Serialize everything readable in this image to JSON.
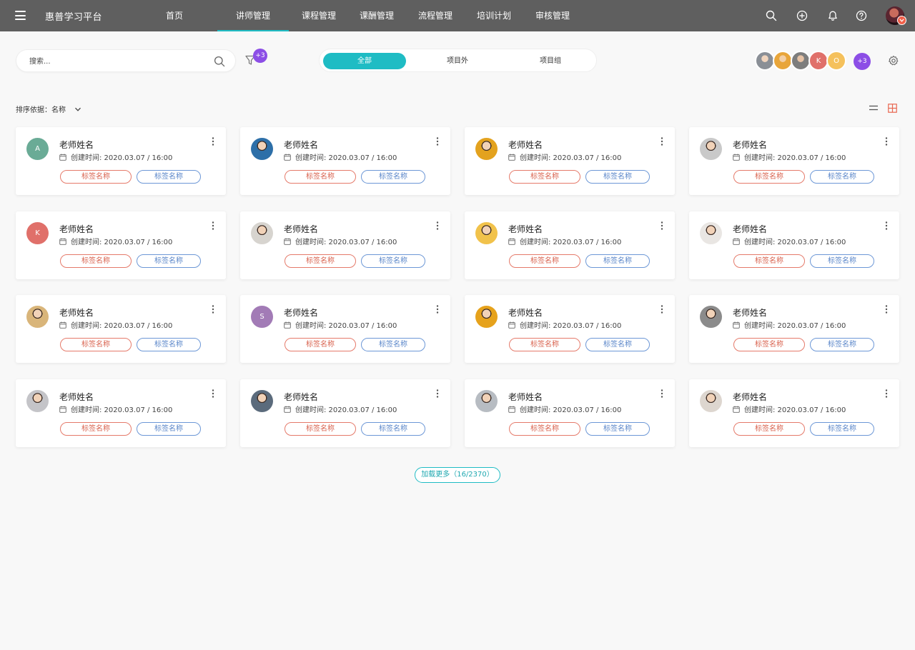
{
  "app": {
    "title": "惠普学习平台"
  },
  "nav": {
    "items": [
      {
        "label": "首页",
        "active": false
      },
      {
        "label": "讲师管理",
        "active": true
      },
      {
        "label": "课程管理",
        "active": false
      },
      {
        "label": "课酬管理",
        "active": false
      },
      {
        "label": "流程管理",
        "active": false
      },
      {
        "label": "培训计划",
        "active": false
      },
      {
        "label": "审核管理",
        "active": false
      }
    ]
  },
  "search": {
    "placeholder": "搜索...",
    "value": ""
  },
  "filter": {
    "badge": "+3"
  },
  "segments": [
    {
      "label": "全部",
      "active": true
    },
    {
      "label": "项目外",
      "active": false
    },
    {
      "label": "项目组",
      "active": false
    }
  ],
  "people": {
    "avatars": [
      {
        "initial": "",
        "color": "#8a8f96"
      },
      {
        "initial": "",
        "color": "#e8a53a"
      },
      {
        "initial": "",
        "color": "#7d7d7d"
      },
      {
        "initial": "K",
        "color": "#e0706a"
      },
      {
        "initial": "O",
        "color": "#f5c15c"
      }
    ],
    "more": "+3"
  },
  "sort": {
    "label": "排序依据：",
    "value": "名称"
  },
  "cards": [
    {
      "name": "老师姓名",
      "date": "创建时间: 2020.03.07 / 16:00",
      "initial": "A",
      "color": "#6aab96",
      "tag_red": "标签名称",
      "tag_blue": "标签名称"
    },
    {
      "name": "老师姓名",
      "date": "创建时间: 2020.03.07 / 16:00",
      "initial": "",
      "color": "#2d6fa8",
      "tag_red": "标签名称",
      "tag_blue": "标签名称"
    },
    {
      "name": "老师姓名",
      "date": "创建时间: 2020.03.07 / 16:00",
      "initial": "",
      "color": "#e3a21e",
      "tag_red": "标签名称",
      "tag_blue": "标签名称"
    },
    {
      "name": "老师姓名",
      "date": "创建时间: 2020.03.07 / 16:00",
      "initial": "",
      "color": "#c9c9c9",
      "tag_red": "标签名称",
      "tag_blue": "标签名称"
    },
    {
      "name": "老师姓名",
      "date": "创建时间: 2020.03.07 / 16:00",
      "initial": "K",
      "color": "#e0706a",
      "tag_red": "标签名称",
      "tag_blue": "标签名称"
    },
    {
      "name": "老师姓名",
      "date": "创建时间: 2020.03.07 / 16:00",
      "initial": "",
      "color": "#d7d4cf",
      "tag_red": "标签名称",
      "tag_blue": "标签名称"
    },
    {
      "name": "老师姓名",
      "date": "创建时间: 2020.03.07 / 16:00",
      "initial": "",
      "color": "#f1c24b",
      "tag_red": "标签名称",
      "tag_blue": "标签名称"
    },
    {
      "name": "老师姓名",
      "date": "创建时间: 2020.03.07 / 16:00",
      "initial": "",
      "color": "#e9e6e3",
      "tag_red": "标签名称",
      "tag_blue": "标签名称"
    },
    {
      "name": "老师姓名",
      "date": "创建时间: 2020.03.07 / 16:00",
      "initial": "",
      "color": "#d9b57a",
      "tag_red": "标签名称",
      "tag_blue": "标签名称"
    },
    {
      "name": "老师姓名",
      "date": "创建时间: 2020.03.07 / 16:00",
      "initial": "S",
      "color": "#a27bb6",
      "tag_red": "标签名称",
      "tag_blue": "标签名称"
    },
    {
      "name": "老师姓名",
      "date": "创建时间: 2020.03.07 / 16:00",
      "initial": "",
      "color": "#e6a21c",
      "tag_red": "标签名称",
      "tag_blue": "标签名称"
    },
    {
      "name": "老师姓名",
      "date": "创建时间: 2020.03.07 / 16:00",
      "initial": "",
      "color": "#8b8b8b",
      "tag_red": "标签名称",
      "tag_blue": "标签名称"
    },
    {
      "name": "老师姓名",
      "date": "创建时间: 2020.03.07 / 16:00",
      "initial": "",
      "color": "#c4c4c8",
      "tag_red": "标签名称",
      "tag_blue": "标签名称"
    },
    {
      "name": "老师姓名",
      "date": "创建时间: 2020.03.07 / 16:00",
      "initial": "",
      "color": "#5b6b7c",
      "tag_red": "标签名称",
      "tag_blue": "标签名称"
    },
    {
      "name": "老师姓名",
      "date": "创建时间: 2020.03.07 / 16:00",
      "initial": "",
      "color": "#b7bcc2",
      "tag_red": "标签名称",
      "tag_blue": "标签名称"
    },
    {
      "name": "老师姓名",
      "date": "创建时间: 2020.03.07 / 16:00",
      "initial": "",
      "color": "#ddd6cf",
      "tag_red": "标签名称",
      "tag_blue": "标签名称"
    }
  ],
  "load_more": {
    "label": "加载更多（16/2370）"
  },
  "colors": {
    "accent": "#1fbcc4",
    "purple": "#8c4ee6",
    "topbar": "#5f5f5f",
    "tag_red": "#e57a6a",
    "tag_blue": "#6c97d6"
  },
  "icons": [
    "menu-icon",
    "search-icon",
    "plus-circle-icon",
    "bell-icon",
    "help-icon",
    "filter-icon",
    "gear-icon",
    "chevron-down-icon",
    "list-view-icon",
    "grid-view-icon",
    "calendar-icon",
    "more-vertical-icon"
  ]
}
